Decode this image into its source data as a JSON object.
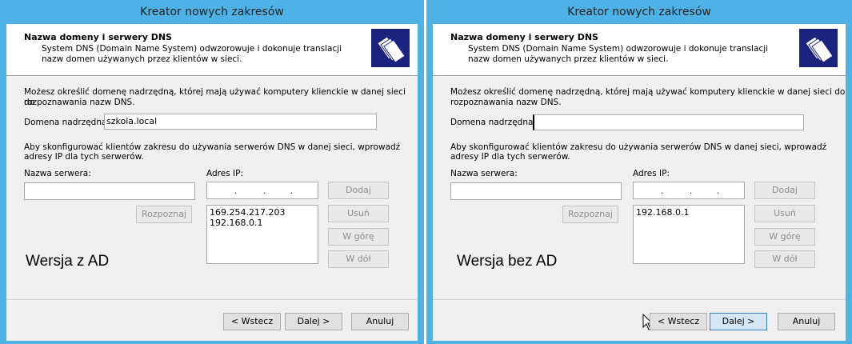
{
  "left": {
    "title": "Kreator nowych zakresów",
    "header_title": "Nazwa domeny i serwery DNS",
    "header_desc": "System DNS (Domain Name System) odwzorowuje i dokonuje translacji nazw domen używanych przez klientów w sieci.",
    "intro_line1": "Możesz określić domenę nadrzędną, której mają używać komputery klienckie w danej sieci do",
    "intro_line2": "rozpoznawania nazw DNS.",
    "domain_label": "Domena nadrzędna:",
    "domain_value": "szkola.local",
    "dns_line1": "Aby skonfigurować klientów zakresu do używania serwerów DNS w danej sieci, wprowadź",
    "dns_line2": "adresy IP dla tych serwerów.",
    "server_label": "Nazwa serwera:",
    "ip_label": "Adres IP:",
    "ip_dots": [
      ".",
      ".",
      "."
    ],
    "resolve_btn": "Rozpoznaj",
    "add_btn": "Dodaj",
    "remove_btn": "Usuń",
    "up_btn": "W górę",
    "down_btn": "W dół",
    "ip_list": [
      "169.254.217.203",
      "192.168.0.1"
    ],
    "caption": "Wersja z AD",
    "back_btn": "< Wstecz",
    "next_btn": "Dalej >",
    "cancel_btn": "Anuluj"
  },
  "right": {
    "title": "Kreator nowych zakresów",
    "header_title": "Nazwa domeny i serwery DNS",
    "header_desc": "System DNS (Domain Name System) odwzorowuje i dokonuje translacji nazw domen używanych przez klientów w sieci.",
    "intro_line1": "Możesz określić domenę nadrzędną, której mają używać komputery klienckie w danej sieci do",
    "intro_line2": "rozpoznawania nazw DNS.",
    "domain_label": "Domena nadrzędna:",
    "domain_value": "",
    "dns_line1": "Aby skonfigurować klientów zakresu do używania serwerów DNS w danej sieci, wprowadź",
    "dns_line2": "adresy IP dla tych serwerów.",
    "server_label": "Nazwa serwera:",
    "ip_label": "Adres IP:",
    "ip_dots": [
      ".",
      ".",
      "."
    ],
    "resolve_btn": "Rozpoznaj",
    "add_btn": "Dodaj",
    "remove_btn": "Usuń",
    "up_btn": "W górę",
    "down_btn": "W dół",
    "ip_list": [
      "192.168.0.1"
    ],
    "caption": "Wersja bez AD",
    "back_btn": "< Wstecz",
    "next_btn": "Dalej >",
    "cancel_btn": "Anuluj"
  },
  "colors": {
    "frame": "#4fb2e6",
    "dialog": "#f0f0f0",
    "header_bg": "#ffffff",
    "icon_bg": "#1a237e"
  }
}
